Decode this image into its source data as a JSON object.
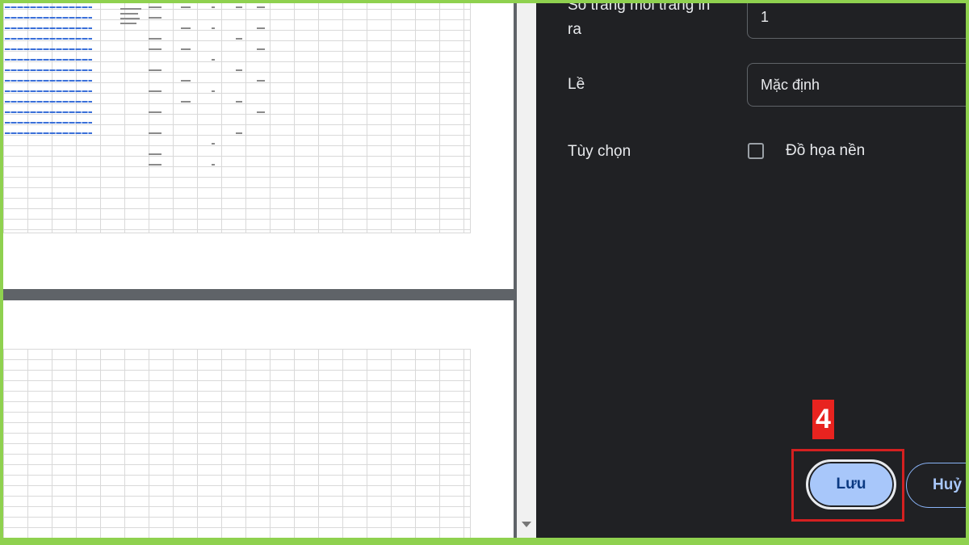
{
  "settings": {
    "pages_per_sheet_label": "Số trang mỗi trang in ra",
    "pages_per_sheet_value": "1",
    "margins_label": "Lề",
    "margins_value": "Mặc định",
    "options_label": "Tùy chọn",
    "background_graphics_label": "Đồ họa nền",
    "background_graphics_checked": false
  },
  "annotation": {
    "step_number": "4",
    "marker_color": "#e8231f"
  },
  "actions": {
    "save_label": "Lưu",
    "cancel_label": "Huỷ"
  },
  "colors": {
    "panel_bg": "#202124",
    "save_button_bg": "#a8c7fa",
    "frame_border": "#8fd14f"
  }
}
